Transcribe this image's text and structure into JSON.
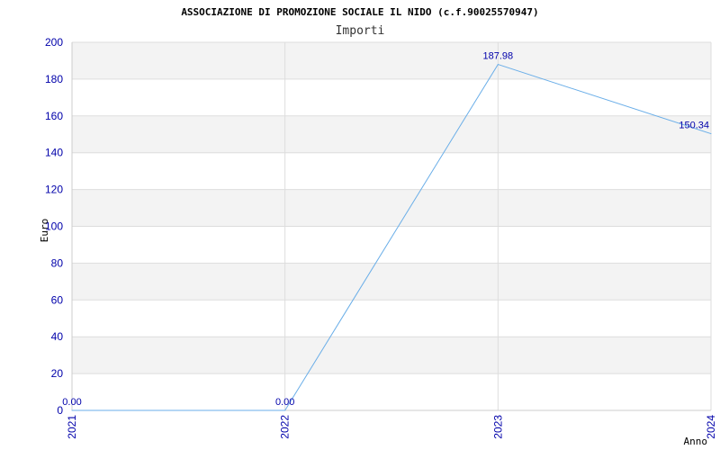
{
  "chart_data": {
    "type": "line",
    "title": "ASSOCIAZIONE DI PROMOZIONE SOCIALE IL NIDO (c.f.90025570947)",
    "subtitle": "Importi",
    "xlabel": "Anno",
    "ylabel": "Euro",
    "categories": [
      "2021",
      "2022",
      "2023",
      "2024"
    ],
    "values": [
      0.0,
      0.0,
      187.98,
      150.34
    ],
    "data_labels": [
      "0.00",
      "0.00",
      "187.98",
      "150.34"
    ],
    "ylim": [
      0,
      200
    ],
    "yticks": [
      "0",
      "20",
      "40",
      "60",
      "80",
      "100",
      "120",
      "140",
      "160",
      "180",
      "200"
    ],
    "grid": true,
    "colors": {
      "line": "#6aaee8",
      "band": "#f3f3f3",
      "gridline": "#dddddd",
      "tick_text": "#0000aa"
    }
  }
}
